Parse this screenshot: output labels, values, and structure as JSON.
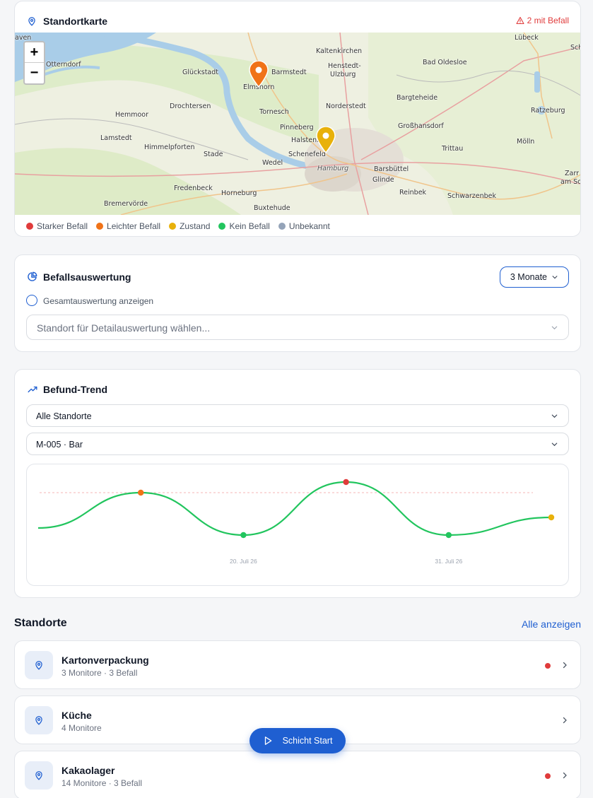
{
  "map_card": {
    "title": "Standortkarte",
    "alert": "2 mit Befall",
    "zoom_in": "+",
    "zoom_out": "−",
    "places": [
      {
        "name": "Lübeck"
      },
      {
        "name": "Sch"
      },
      {
        "name": "aven"
      },
      {
        "name": "Kaltenkirchen"
      },
      {
        "name": "Otterndorf"
      },
      {
        "name": "Glückstadt"
      },
      {
        "name": "Barmstedt"
      },
      {
        "name": "Henstedt-"
      },
      {
        "name": "Ulzburg"
      },
      {
        "name": "Bad Oldesloe"
      },
      {
        "name": "Elmshorn"
      },
      {
        "name": "Bargteheide"
      },
      {
        "name": "Hemmoor"
      },
      {
        "name": "Drochtersen"
      },
      {
        "name": "Tornesch"
      },
      {
        "name": "Norderstedt"
      },
      {
        "name": "Ratzeburg"
      },
      {
        "name": "Pinneberg"
      },
      {
        "name": "Großhansdorf"
      },
      {
        "name": "Lamstedt"
      },
      {
        "name": "Himmelpforten"
      },
      {
        "name": "Halstenbek"
      },
      {
        "name": "Schenefeld"
      },
      {
        "name": "Trittau"
      },
      {
        "name": "Mölln"
      },
      {
        "name": "Stade"
      },
      {
        "name": "Wedel"
      },
      {
        "name": "Hamburg"
      },
      {
        "name": "Barsbüttel"
      },
      {
        "name": "Glinde"
      },
      {
        "name": "Fredenbeck"
      },
      {
        "name": "Reinbek"
      },
      {
        "name": "Schwarzenbek"
      },
      {
        "name": "Horneburg"
      },
      {
        "name": "Bremervörde"
      },
      {
        "name": "Buxtehude"
      },
      {
        "name": "Zarr"
      },
      {
        "name": "am Sc"
      }
    ],
    "legend": [
      {
        "label": "Starker Befall",
        "color": "#e03b3b"
      },
      {
        "label": "Leichter Befall",
        "color": "#f07318"
      },
      {
        "label": "Zustand",
        "color": "#e8b10b"
      },
      {
        "label": "Kein Befall",
        "color": "#22c55e"
      },
      {
        "label": "Unbekannt",
        "color": "#94a3b8"
      }
    ]
  },
  "analysis_card": {
    "title": "Befallsauswertung",
    "period": "3 Monate",
    "overall_label": "Gesamtauswertung anzeigen",
    "location_placeholder": "Standort für Detailauswertung wählen..."
  },
  "trend_card": {
    "title": "Befund-Trend",
    "location_select": "Alle Standorte",
    "monitor_select": "M-005 · Bar"
  },
  "chart_data": {
    "type": "line",
    "x_tick_labels": [
      "20. Juli 26",
      "31. Juli 26"
    ],
    "series": [
      {
        "values": [
          {
            "y": 0.65,
            "status": "none"
          },
          {
            "y": 0.15,
            "status": "leicht"
          },
          {
            "y": 0.75,
            "status": "kein"
          },
          {
            "y": 0.0,
            "status": "stark"
          },
          {
            "y": 0.75,
            "status": "kein"
          },
          {
            "y": 0.5,
            "status": "zustand"
          }
        ]
      }
    ],
    "threshold": 0.15,
    "colors": {
      "line": "#22c55e",
      "stark": "#e03b3b",
      "leicht": "#f07318",
      "zustand": "#e8b10b",
      "kein": "#22c55e",
      "threshold": "#f5b5b5"
    }
  },
  "locations_section": {
    "title": "Standorte",
    "show_all": "Alle anzeigen",
    "items": [
      {
        "name": "Kartonverpackung",
        "details": "3 Monitore · 3 Befall",
        "alert": true
      },
      {
        "name": "Küche",
        "details": "4 Monitore",
        "alert": false
      },
      {
        "name": "Kakaolager",
        "details": "14 Monitore · 3 Befall",
        "alert": true
      }
    ]
  },
  "fab": {
    "label": "Schicht Start"
  },
  "colors": {
    "accent": "#1f5fd1",
    "alert": "#e03b3b"
  }
}
